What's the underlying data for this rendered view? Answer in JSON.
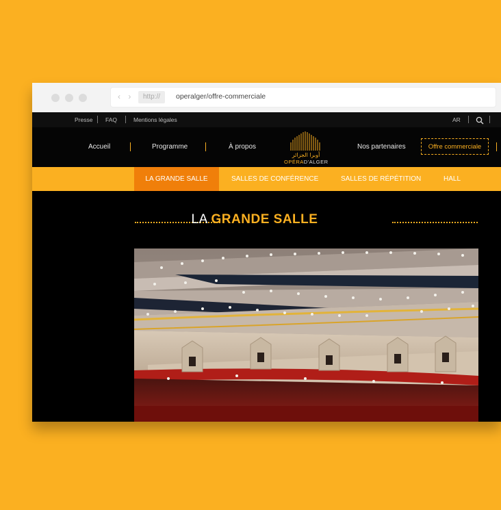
{
  "browser": {
    "nav_arrows": "‹ ›",
    "protocol": "http://",
    "url": "operalger/offre-commerciale"
  },
  "utility_nav": {
    "left": [
      "Presse",
      "FAQ",
      "Mentions légales"
    ],
    "lang": "AR",
    "search_icon": "search-icon"
  },
  "main_nav": {
    "items": [
      "Accueil",
      "Programme",
      "À propos",
      "Nos partenaires"
    ],
    "cta": "Offre commerciale"
  },
  "logo": {
    "arabic": "أوبرا الجزائر",
    "opera": "OPÉRA",
    "alger": "D'ALGER"
  },
  "sub_nav": {
    "tabs": [
      "LA GRANDE SALLE",
      "SALLES DE CONFÉRENCE",
      "SALLES DE RÉPÉTITION",
      "HALL"
    ],
    "active_index": 0
  },
  "section": {
    "title_prefix": "LA",
    "title_accent": "GRANDE SALLE"
  },
  "colors": {
    "accent": "#fbb021",
    "active_tab": "#f07f0a",
    "background": "#000000"
  }
}
